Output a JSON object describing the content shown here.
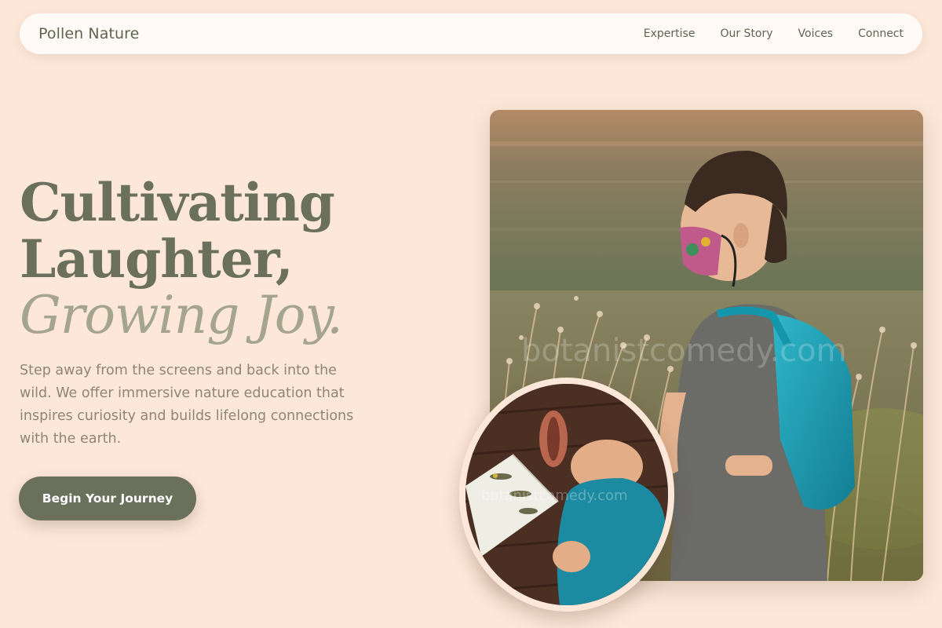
{
  "brand": {
    "name": "Pollen Nature"
  },
  "nav": {
    "links": [
      {
        "label": "Expertise"
      },
      {
        "label": "Our Story"
      },
      {
        "label": "Voices"
      },
      {
        "label": "Connect"
      }
    ]
  },
  "hero": {
    "title_line1": "Cultivating",
    "title_line2": "Laughter,",
    "title_accent": "Growing Joy.",
    "description": "Step away from the screens and back into the wild. We offer immersive nature education that inspires curiosity and builds lifelong connections with the earth.",
    "cta_label": "Begin Your Journey"
  },
  "images": {
    "main_alt": "Boy with backpack and face mask by a pond among dry grasses",
    "inset_alt": "Child reading a bird field guide on a wooden deck",
    "watermark": "botanistcomedy.com"
  },
  "colors": {
    "background": "#fde7d8",
    "primary": "#6b705c",
    "accent": "#a5a58d",
    "navbar": "#fffaf5"
  }
}
